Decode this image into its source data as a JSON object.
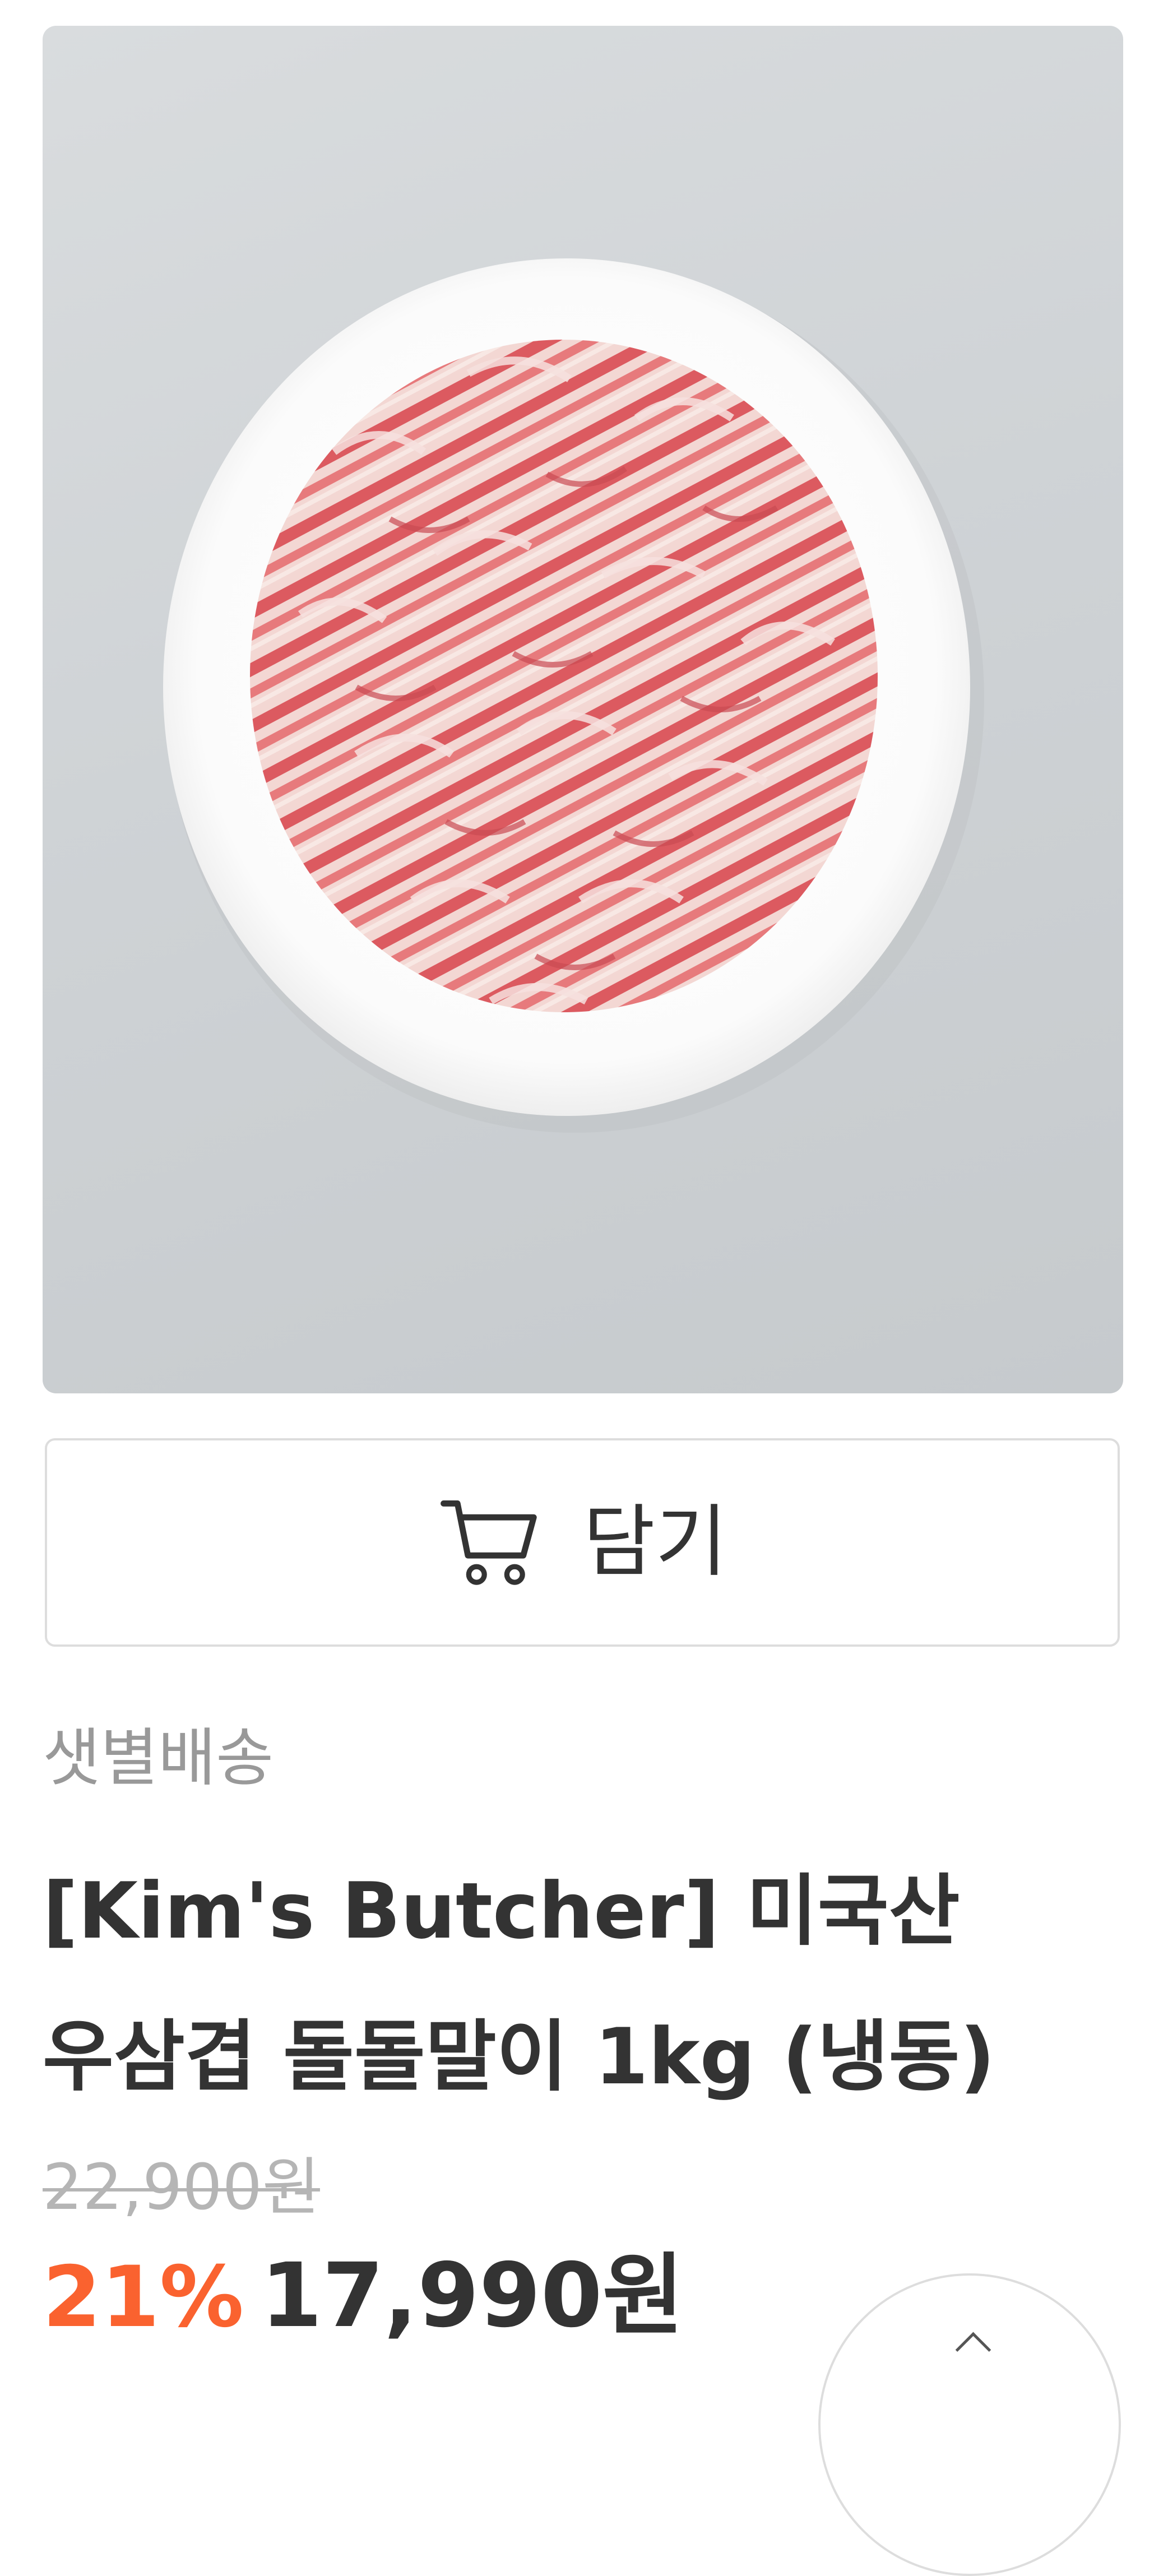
{
  "product": {
    "image_alt": "미국산 우삼겹 돌돌말이",
    "cart_button_label": "담기",
    "cart_icon": "cart-icon",
    "delivery_tag": "샛별배송",
    "name_line1": "[Kim's Butcher] 미국산",
    "name_line2": "우삼겹 돌돌말이 1kg (냉동)",
    "original_price": "22,900원",
    "discount_rate": "21%",
    "sale_price": "17,990원"
  },
  "colors": {
    "discount": "#fa622f",
    "text": "#333333",
    "muted": "#999999",
    "strikethrough": "#b5b5b5",
    "border": "#dddddd"
  }
}
